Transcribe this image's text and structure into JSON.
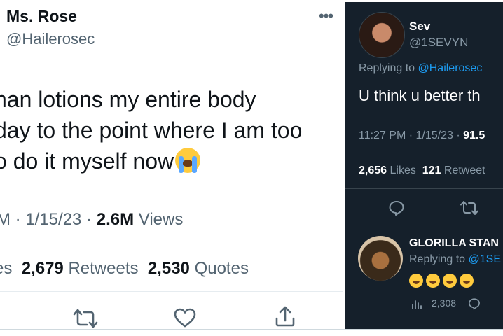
{
  "left_tweet": {
    "author_name": "Ms. Rose",
    "handle": "@Hailerosec",
    "more_label": "•••",
    "text_lines": [
      "han lotions my entire body",
      "day to the point where I am too",
      "o do it myself now"
    ],
    "emoji": "loudly-crying-face",
    "time_partial": "M · 1/15/23 · ",
    "views_count": "2.6M",
    "views_label": " Views",
    "likes_label_partial": "es",
    "retweets_count": "2,679",
    "retweets_label": "Retweets",
    "quotes_count": "2,530",
    "quotes_label": "Quotes",
    "action_icons": [
      "retweet-icon",
      "heart-icon",
      "share-icon"
    ]
  },
  "right_tweet": {
    "author_name": "Sev",
    "handle": "@1SEVYN",
    "replying_prefix": "Replying to ",
    "replying_to": "@Hailerosec",
    "text": "U think u better th",
    "time": "11:27 PM · 1/15/23 · ",
    "views_partial": "91.5",
    "likes_count": "2,656",
    "likes_label": "Likes",
    "retweets_count": "121",
    "retweets_label": "Retweet",
    "action_icons": [
      "reply-icon",
      "retweet-icon"
    ],
    "reply": {
      "author_name": "GLORILLA STAN",
      "replying_prefix": "Replying to ",
      "replying_to": "@1SE",
      "emojis": [
        "laughing-face",
        "laughing-face",
        "laughing-face",
        "laughing-face"
      ],
      "views_count": "2,308"
    }
  },
  "colors": {
    "light_text": "#0f1419",
    "light_secondary": "#536471",
    "dark_bg": "#15202b",
    "dark_secondary": "#8899a6",
    "link_blue": "#1d9bf0"
  }
}
